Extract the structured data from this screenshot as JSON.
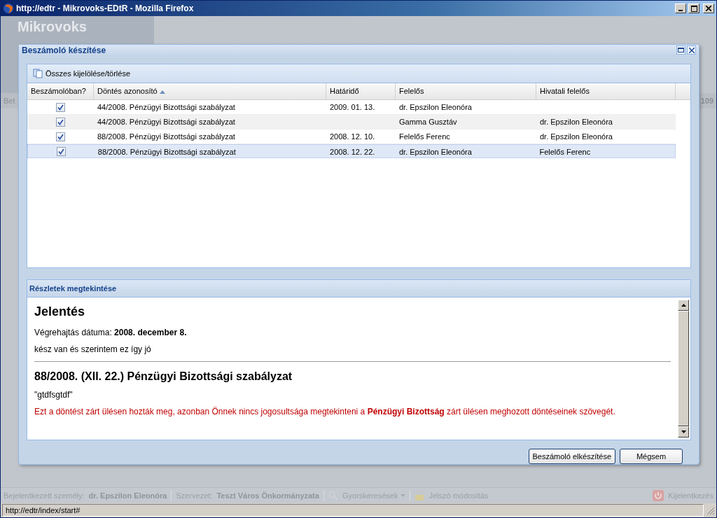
{
  "browser": {
    "title": "http://edtr - Mikrovoks-EDtR - Mozilla Firefox",
    "status_url": "http://edtr/index/start#"
  },
  "app": {
    "logo": "Mikrovoks",
    "left_cut": "Bet",
    "right_cut": "109",
    "footer": {
      "user_label": "Bejelentkezett személy:",
      "user": "dr. Epszilon Eleonóra",
      "org_label": "Szervezet:",
      "org": "Teszt Város Önkormányzata",
      "quick_search": "Gyorskeresések",
      "password": "Jelszó módosítás",
      "logout": "Kijelentkezés"
    }
  },
  "dialog": {
    "title": "Beszámoló készítése",
    "toolbar_button": "Összes kijelölése/törlése",
    "table": {
      "checkbox_column": "Beszámolóban?",
      "columns": [
        {
          "label": "Döntés azonosító",
          "sorted": true
        },
        {
          "label": "Határidő",
          "sorted": false
        },
        {
          "label": "Felelős",
          "sorted": false
        },
        {
          "label": "Hivatali felelős",
          "sorted": false
        }
      ],
      "rows": [
        {
          "checked": true,
          "selected": false,
          "cells": [
            "44/2008. Pénzügyi Bizottsági szabályzat",
            "2009. 01. 13.",
            "dr. Epszilon Eleonóra",
            ""
          ]
        },
        {
          "checked": true,
          "selected": false,
          "cells": [
            "44/2008. Pénzügyi Bizottsági szabályzat",
            "",
            "Gamma Gusztáv",
            "dr. Epszilon Eleonóra"
          ]
        },
        {
          "checked": true,
          "selected": false,
          "cells": [
            "88/2008. Pénzügyi Bizottsági szabályzat",
            "2008. 12. 10.",
            "Felelős Ferenc",
            "dr. Epszilon Eleonóra"
          ]
        },
        {
          "checked": true,
          "selected": true,
          "cells": [
            "88/2008. Pénzügyi Bizottsági szabályzat",
            "2008. 12. 22.",
            "dr. Epszilon Eleonóra",
            "Felelős Ferenc"
          ]
        }
      ]
    },
    "details": {
      "title": "Részletek megtekintése",
      "heading": "Jelentés",
      "date_line": "Végrehajtás dátuma: **2008. december 8.**",
      "note": "kész van és szerintem ez így jó",
      "decision_title": "88/2008. (XII. 22.) Pénzügyi Bizottsági szabályzat",
      "quote": "\"gtdfsgtdf\"",
      "warning": "Ezt a döntést zárt ülésen hozták meg, azonban Önnek nincs jogosultsága megtekinteni a **Pénzügyi Bizottság** zárt ülésen meghozott döntéseinek szövegét."
    },
    "buttons": [
      "Beszámoló elkészítése",
      "Mégsem"
    ]
  }
}
